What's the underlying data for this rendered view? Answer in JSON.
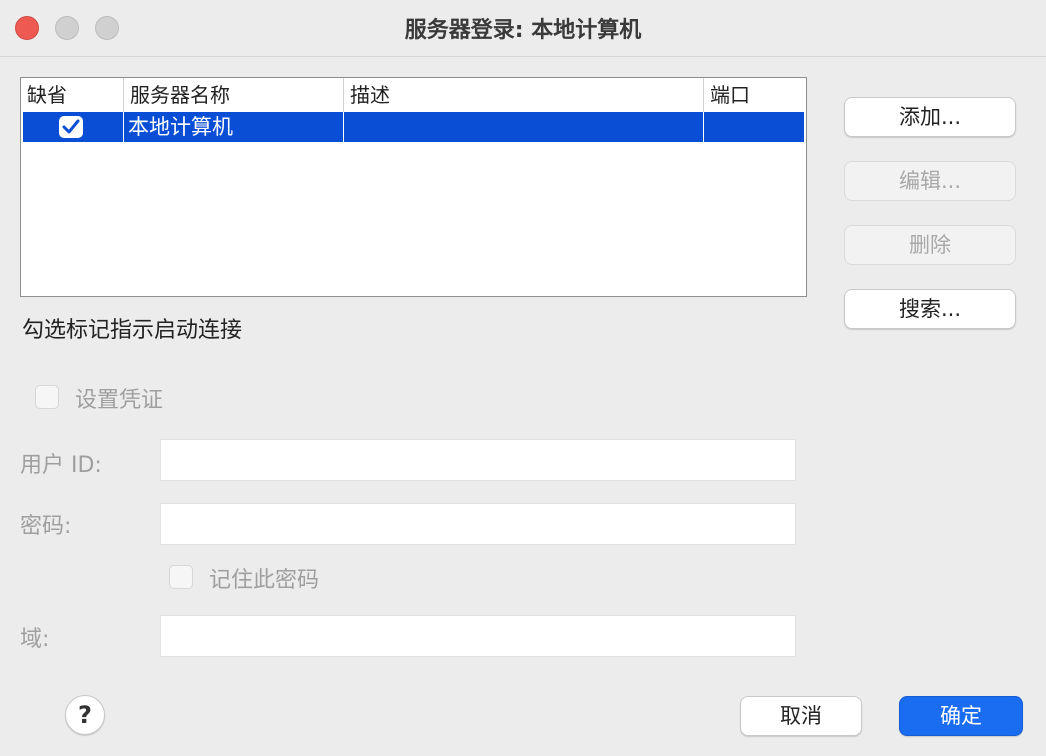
{
  "window": {
    "title": "服务器登录: 本地计算机"
  },
  "table": {
    "columns": [
      "缺省",
      "服务器名称",
      "描述",
      "端口"
    ],
    "rows": [
      {
        "default_checked": true,
        "name": "本地计算机",
        "description": "",
        "port": ""
      }
    ],
    "selection_color": "#0a4ed6"
  },
  "hint_text": "勾选标记指示启动连接",
  "buttons": {
    "add": "添加...",
    "edit": "编辑...",
    "delete": "删除",
    "search": "搜索...",
    "cancel": "取消",
    "ok": "确定",
    "help": "?"
  },
  "credentials": {
    "set_credentials_label": "设置凭证",
    "user_id_label": "用户 ID:",
    "password_label": "密码:",
    "remember_password_label": "记住此密码",
    "domain_label": "域:",
    "user_id_value": "",
    "password_value": "",
    "domain_value": ""
  },
  "colors": {
    "primary": "#1a6df0",
    "close": "#ee5a52"
  }
}
